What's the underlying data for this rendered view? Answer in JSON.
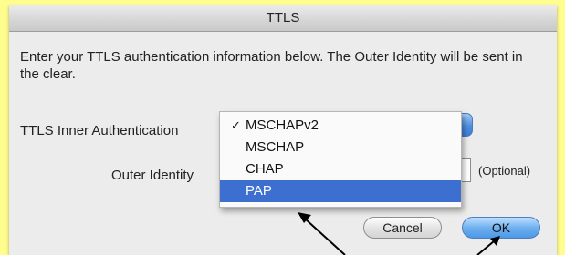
{
  "dialog": {
    "title": "TTLS",
    "description": "Enter your TTLS authentication information below. The Outer Identity will be sent in the clear.",
    "inner_auth_label": "TTLS Inner Authentication",
    "outer_identity_label": "Outer Identity",
    "outer_identity_value": "",
    "optional_hint": "(Optional)",
    "inner_auth_options": [
      {
        "label": "MSCHAPv2",
        "checked": true,
        "highlighted": false
      },
      {
        "label": "MSCHAP",
        "checked": false,
        "highlighted": false
      },
      {
        "label": "CHAP",
        "checked": false,
        "highlighted": false
      },
      {
        "label": "PAP",
        "checked": false,
        "highlighted": true
      }
    ],
    "check_glyph": "✓",
    "cancel_label": "Cancel",
    "ok_label": "OK"
  },
  "colors": {
    "page_background": "#fffd8e",
    "menu_highlight": "#3d6fd1",
    "default_button": "#6fb0ef"
  },
  "annotations": [
    "arrow-to-menu",
    "arrow-to-ok-button"
  ]
}
